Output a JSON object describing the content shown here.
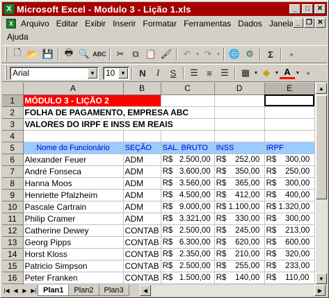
{
  "window": {
    "title": "Microsoft Excel - Modulo 3 - Lição 1.xls"
  },
  "menu": {
    "items": [
      "Arquivo",
      "Editar",
      "Exibir",
      "Inserir",
      "Formatar",
      "Ferramentas",
      "Dados",
      "Janela"
    ],
    "second_row": [
      "Ajuda"
    ]
  },
  "toolbar": {
    "font_name": "Arial",
    "font_size": "10",
    "bold": "N",
    "italic": "I",
    "underline": "S",
    "sum": "Σ",
    "font_color_letter": "A"
  },
  "sheet": {
    "columns": [
      "A",
      "B",
      "C",
      "D",
      "E"
    ],
    "rows": [
      {
        "n": "1",
        "cells": [
          "MÓDULO 3 - LIÇÃO 2",
          "",
          "",
          "",
          ""
        ]
      },
      {
        "n": "2",
        "cells": [
          "FOLHA DE PAGAMENTO, EMPRESA ABC",
          "",
          "",
          "",
          ""
        ]
      },
      {
        "n": "3",
        "cells": [
          "VALORES DO IRPF E INSS EM REAIS",
          "",
          "",
          "",
          ""
        ]
      },
      {
        "n": "4",
        "cells": [
          "",
          "",
          "",
          "",
          ""
        ]
      },
      {
        "n": "5",
        "cells": [
          "Nome do Funcionário",
          "SEÇÃO",
          "SAL. BRUTO",
          "INSS",
          "IRPF"
        ]
      },
      {
        "n": "6",
        "cells": [
          "Alexander Feuer",
          "ADM",
          "R$   2.500,00",
          "R$    252,00",
          "R$    300,00"
        ]
      },
      {
        "n": "7",
        "cells": [
          "André Fonseca",
          "ADM",
          "R$   3.600,00",
          "R$    350,00",
          "R$    250,00"
        ]
      },
      {
        "n": "8",
        "cells": [
          "Hanna Moos",
          "ADM",
          "R$   3.560,00",
          "R$    365,00",
          "R$    300,00"
        ]
      },
      {
        "n": "9",
        "cells": [
          "Henriette Pfalzheim",
          "ADM",
          "R$   4.500,00",
          "R$    412,00",
          "R$    400,00"
        ]
      },
      {
        "n": "10",
        "cells": [
          "Pascale Cartrain",
          "ADM",
          "R$   9.000,00",
          "R$ 1.100,00",
          "R$ 1.320,00"
        ]
      },
      {
        "n": "11",
        "cells": [
          "Philip Cramer",
          "ADM",
          "R$   3.321,00",
          "R$    330,00",
          "R$    300,00"
        ]
      },
      {
        "n": "12",
        "cells": [
          "Catherine Dewey",
          "CONTAB",
          "R$   2.500,00",
          "R$    245,00",
          "R$    213,00"
        ]
      },
      {
        "n": "13",
        "cells": [
          "Georg Pipps",
          "CONTAB",
          "R$   6.300,00",
          "R$    620,00",
          "R$    600,00"
        ]
      },
      {
        "n": "14",
        "cells": [
          "Horst Kloss",
          "CONTAB",
          "R$   2.350,00",
          "R$    210,00",
          "R$    320,00"
        ]
      },
      {
        "n": "15",
        "cells": [
          "Patricio Simpson",
          "CONTAB",
          "R$   2.500,00",
          "R$    255,00",
          "R$    233,00"
        ]
      },
      {
        "n": "16",
        "cells": [
          "Peter Franken",
          "CONTAB",
          "R$   1.500,00",
          "R$    140,00",
          "R$    110,00"
        ]
      }
    ]
  },
  "tabs": [
    "Plan1",
    "Plan2",
    "Plan3"
  ],
  "colors": {
    "title_bar": "#a40000",
    "title_cell_bg": "#ff0000",
    "header_row_bg": "#99ccff",
    "header_row_text": "#0000cc"
  },
  "icons": [
    "excel-app-icon",
    "minimize-icon",
    "maximize-icon",
    "close-icon",
    "new-icon",
    "open-icon",
    "save-icon",
    "print-icon",
    "print-preview-icon",
    "spelling-icon",
    "cut-icon",
    "copy-icon",
    "paste-icon",
    "format-painter-icon",
    "undo-icon",
    "redo-icon",
    "hyperlink-icon",
    "web-icon",
    "autosum-icon",
    "align-left-icon",
    "align-center-icon",
    "align-right-icon",
    "borders-icon",
    "fill-color-icon",
    "font-color-icon"
  ]
}
